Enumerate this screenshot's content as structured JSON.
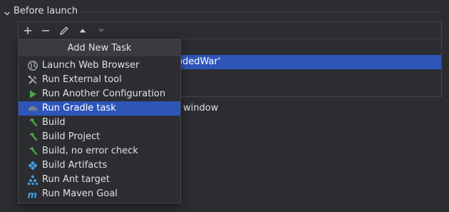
{
  "section": {
    "title": "Before launch"
  },
  "toolbar": {
    "buttons": [
      {
        "icon": "plus-icon"
      },
      {
        "icon": "minus-icon"
      },
      {
        "icon": "pencil-icon"
      },
      {
        "icon": "arrow-up-icon"
      },
      {
        "icon": "arrow-down-icon",
        "disabled": true
      }
    ]
  },
  "tasks": [
    {
      "label": "odedWar'"
    }
  ],
  "background_text": "window",
  "popup": {
    "title": "Add New Task",
    "items": [
      {
        "label": "Launch Web Browser",
        "icon": "globe-icon"
      },
      {
        "label": "Run External tool",
        "icon": "tools-icon"
      },
      {
        "label": "Run Another Configuration",
        "icon": "play-icon"
      },
      {
        "label": "Run Gradle task",
        "icon": "gradle-elephant-icon",
        "selected": true
      },
      {
        "label": "Build",
        "icon": "hammer-icon"
      },
      {
        "label": "Build Project",
        "icon": "hammer-icon"
      },
      {
        "label": "Build, no error check",
        "icon": "hammer-icon"
      },
      {
        "label": "Build Artifacts",
        "icon": "artifact-diamond-icon"
      },
      {
        "label": "Run Ant target",
        "icon": "ant-icon"
      },
      {
        "label": "Run Maven Goal",
        "icon": "maven-icon"
      }
    ]
  },
  "colors": {
    "background": "#2b2d30",
    "selection": "#2e55b8",
    "popup_header": "#393b40",
    "green_icon": "#4ea44b",
    "blue_icon": "#3d9ee0"
  }
}
